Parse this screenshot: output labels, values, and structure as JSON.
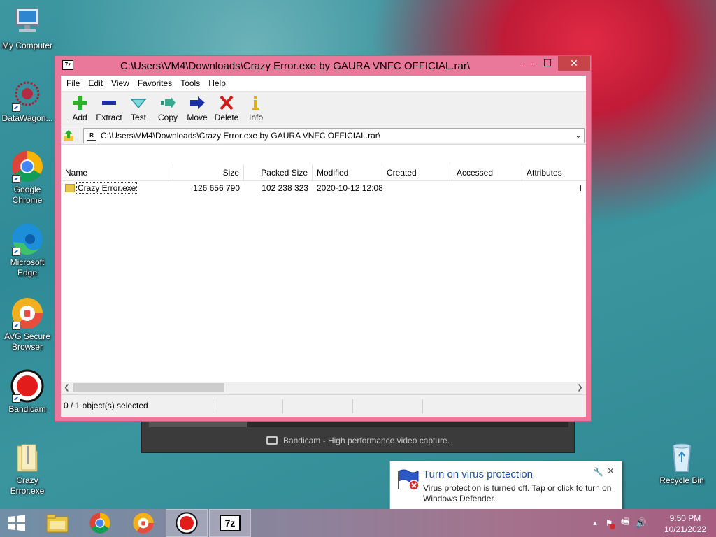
{
  "desktop": {
    "icons": [
      {
        "label": "My Computer"
      },
      {
        "label": "DataWagon..."
      },
      {
        "label": "Google Chrome"
      },
      {
        "label": "Microsoft Edge"
      },
      {
        "label": "AVG Secure Browser"
      },
      {
        "label": "Bandicam"
      },
      {
        "label": "Crazy Error.exe"
      },
      {
        "label": "Recycle Bin"
      }
    ]
  },
  "bandicam": {
    "caption": "Bandicam - High performance video capture."
  },
  "window": {
    "title": "C:\\Users\\VM4\\Downloads\\Crazy Error.exe by GAURA VNFC OFFICIAL.rar\\",
    "app_icon_text": "7z",
    "controls": {
      "minimize": "—",
      "maximize": "☐",
      "close": "✕"
    },
    "menu": [
      "File",
      "Edit",
      "View",
      "Favorites",
      "Tools",
      "Help"
    ],
    "toolbar": [
      {
        "label": "Add",
        "icon": "add-icon"
      },
      {
        "label": "Extract",
        "icon": "extract-icon"
      },
      {
        "label": "Test",
        "icon": "test-icon"
      },
      {
        "label": "Copy",
        "icon": "copy-icon"
      },
      {
        "label": "Move",
        "icon": "move-icon"
      },
      {
        "label": "Delete",
        "icon": "delete-icon"
      },
      {
        "label": "Info",
        "icon": "info-icon"
      }
    ],
    "address": "C:\\Users\\VM4\\Downloads\\Crazy Error.exe by GAURA VNFC OFFICIAL.rar\\",
    "columns": [
      "Name",
      "Size",
      "Packed Size",
      "Modified",
      "Created",
      "Accessed",
      "Attributes"
    ],
    "rows": [
      {
        "name": "Crazy Error.exe",
        "size": "126 656 790",
        "packed": "102 238 323",
        "modified": "2020-10-12 12:08",
        "created": "",
        "accessed": "",
        "attributes": "I"
      }
    ],
    "status": "0 / 1 object(s) selected"
  },
  "notification": {
    "title": "Turn on virus protection",
    "body": "Virus protection is turned off. Tap or click to turn on Windows Defender."
  },
  "taskbar": {
    "clock_time": "9:50 PM",
    "clock_date": "10/21/2022",
    "sevenzip_label": "7z"
  },
  "colors": {
    "window_frame": "#e9789a",
    "close_button": "#c7454a",
    "notification_title": "#1f4fa0"
  }
}
